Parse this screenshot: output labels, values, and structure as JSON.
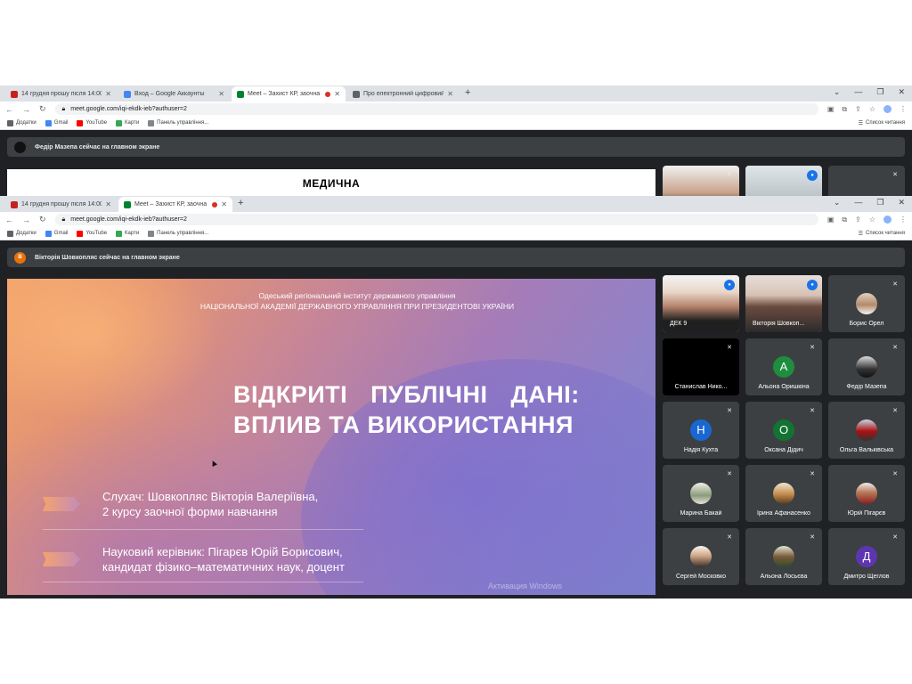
{
  "back_window": {
    "tabs": [
      {
        "title": "14 грудня прошу після 14:00 пі",
        "favicon_color": "#c5221f"
      },
      {
        "title": "Вход – Google Аккаунты",
        "favicon_color": "#4285f4"
      },
      {
        "title": "Meet – Захист КР, заочна ф",
        "favicon_color": "#00832d"
      },
      {
        "title": "Про електронний цифровий пі",
        "favicon_color": "#5f6368"
      }
    ],
    "url": "meet.google.com/iqi-ekdk-ieb?authuser=2",
    "banner": "Федір Мазепа сейчас на главном экране",
    "slide_text": "МЕДИЧНА"
  },
  "front_window": {
    "tabs": [
      {
        "title": "14 грудня прошу після 14:00 пі",
        "favicon_color": "#c5221f"
      },
      {
        "title": "Meet – Захист КР, заочна ф",
        "favicon_color": "#00832d"
      }
    ],
    "url": "meet.google.com/iqi-ekdk-ieb?authuser=2",
    "banner": "Вікторія Шовкопляс сейчас на главном экране",
    "banner_initial": "В",
    "banner_color": "#e8710a"
  },
  "window_controls": {
    "minimize": "—",
    "restore": "❐",
    "close": "✕",
    "tab_list": "⌄"
  },
  "bookmarks": [
    {
      "label": "Додатки",
      "icon": "apps-grid-icon"
    },
    {
      "label": "Gmail",
      "icon": "gmail-icon"
    },
    {
      "label": "YouTube",
      "icon": "youtube-icon"
    },
    {
      "label": "Карти",
      "icon": "maps-icon"
    },
    {
      "label": "Панель управління...",
      "icon": "shield-icon"
    }
  ],
  "reading_list": "Список читання",
  "slide": {
    "institute_line1": "Одеський регіональний інститут державного управління",
    "institute_line2": "НАЦІОНАЛЬНОЇ АКАДЕМІЇ ДЕРЖАВНОГО УПРАВЛІННЯ ПРИ ПРЕЗИДЕНТОВІ УКРАЇНИ",
    "title_line1": "ВІДКРИТІ ПУБЛІЧНІ ДАНІ:",
    "title_line2": "ВПЛИВ ТА ВИКОРИСТАННЯ",
    "student_line1": "Слухач: Шовкопляс Вікторія Валеріївна,",
    "student_line2": "2 курсу заочної форми навчання",
    "advisor_line1": "Науковий керівник: Пігарєв Юрій Борисович,",
    "advisor_line2": "кандидат фізико–математичних наук, доцент",
    "watermark": "Активация Windows"
  },
  "participants": [
    {
      "name": "ДЕК 9",
      "initial": "",
      "color": "#3c4043",
      "mic": "active"
    },
    {
      "name": "Вікторія Шовкоп...",
      "initial": "",
      "color": "#3c4043",
      "mic": "active"
    },
    {
      "name": "Борис Орел",
      "initial": "",
      "color": "#3c4043",
      "mic": "muted"
    },
    {
      "name": "Станислав Нико...",
      "initial": "",
      "color": "#3c4043",
      "mic": "muted"
    },
    {
      "name": "Альона Оришкіна",
      "initial": "А",
      "color": "#1e8e3e",
      "mic": "muted"
    },
    {
      "name": "Федір Мазепа",
      "initial": "",
      "color": "#3c4043",
      "mic": "muted"
    },
    {
      "name": "Надія Кухта",
      "initial": "Н",
      "color": "#1967d2",
      "mic": "muted"
    },
    {
      "name": "Оксана Дідич",
      "initial": "О",
      "color": "#137333",
      "mic": "muted"
    },
    {
      "name": "Ольга Вальківська",
      "initial": "",
      "color": "#3c4043",
      "mic": "muted"
    },
    {
      "name": "Марина Бакай",
      "initial": "",
      "color": "#3c4043",
      "mic": "muted"
    },
    {
      "name": "Ірина Афанасенко",
      "initial": "",
      "color": "#3c4043",
      "mic": "muted"
    },
    {
      "name": "Юрій Пігарєв",
      "initial": "",
      "color": "#3c4043",
      "mic": "muted"
    },
    {
      "name": "Сергей Московко",
      "initial": "",
      "color": "#3c4043",
      "mic": "muted"
    },
    {
      "name": "Альона Лосьєва",
      "initial": "",
      "color": "#3c4043",
      "mic": "muted"
    },
    {
      "name": "Дмитро Щеглов",
      "initial": "Д",
      "color": "#5e35b1",
      "mic": "muted"
    }
  ]
}
